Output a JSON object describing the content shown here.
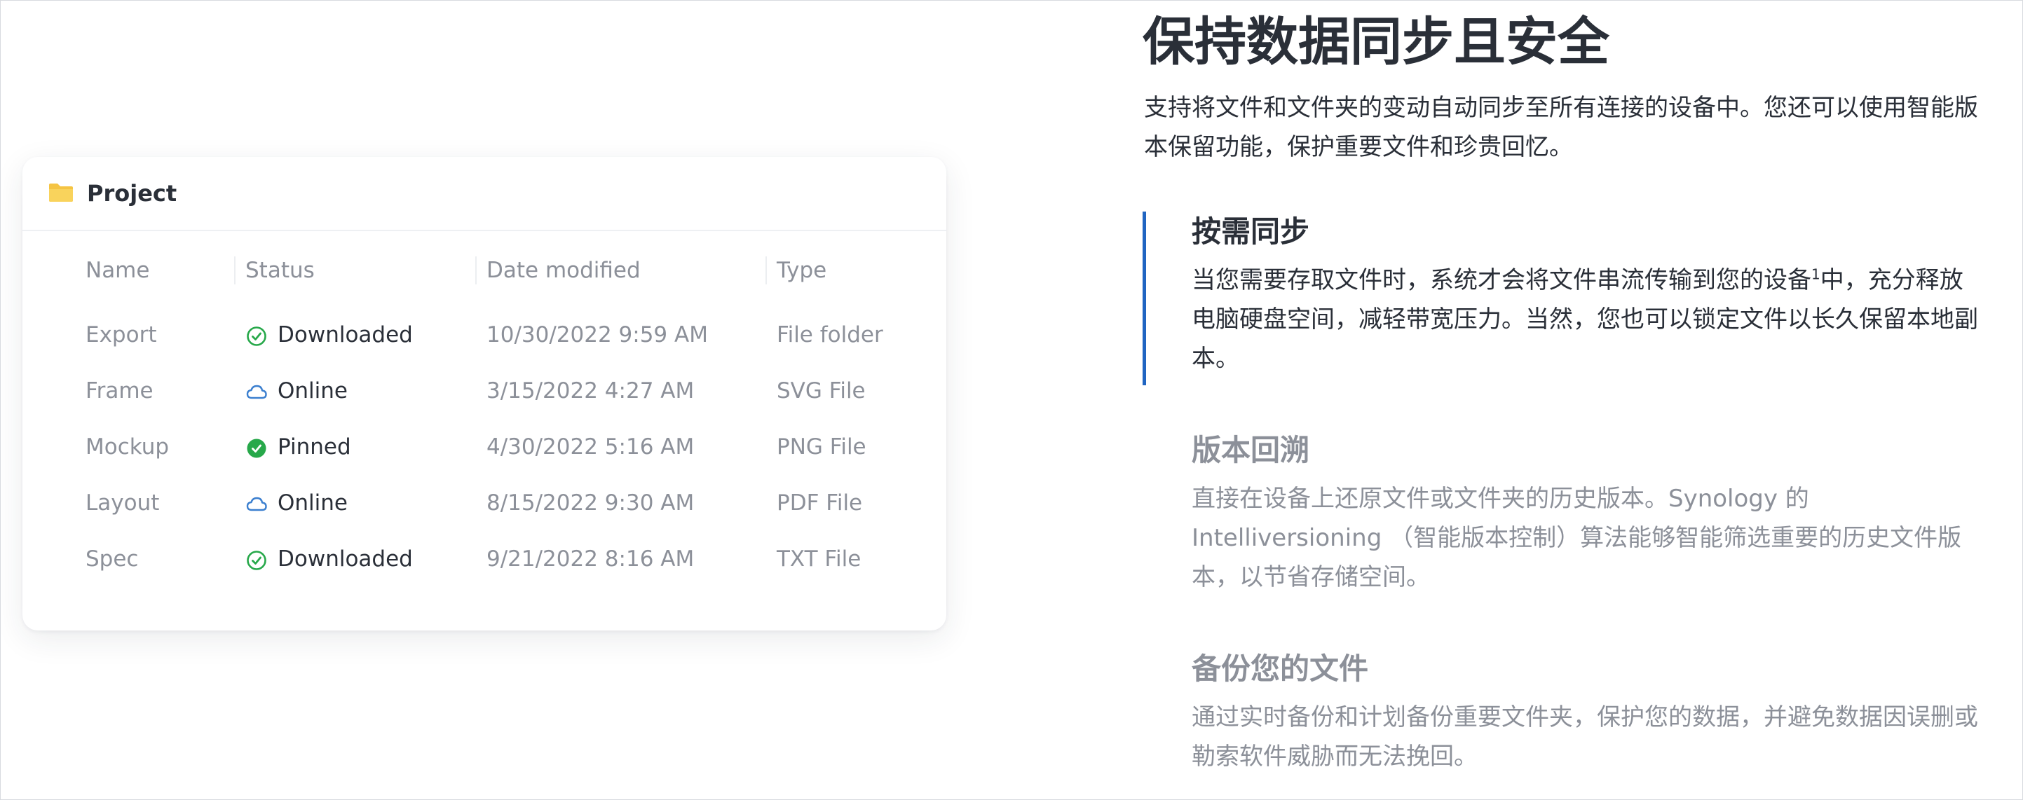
{
  "explorer": {
    "title": "Project",
    "columns": {
      "name": "Name",
      "status": "Status",
      "date": "Date modified",
      "type": "Type"
    },
    "rows": [
      {
        "name": "Export",
        "status": "Downloaded",
        "status_icon": "check-circle-outline-icon",
        "date": "10/30/2022 9:59 AM",
        "type": "File folder"
      },
      {
        "name": "Frame",
        "status": "Online",
        "status_icon": "cloud-icon",
        "date": "3/15/2022 4:27 AM",
        "type": "SVG File"
      },
      {
        "name": "Mockup",
        "status": "Pinned",
        "status_icon": "check-circle-filled-icon",
        "date": "4/30/2022 5:16 AM",
        "type": "PNG File"
      },
      {
        "name": "Layout",
        "status": "Online",
        "status_icon": "cloud-icon",
        "date": "8/15/2022 9:30 AM",
        "type": "PDF File"
      },
      {
        "name": "Spec",
        "status": "Downloaded",
        "status_icon": "check-circle-outline-icon",
        "date": "9/21/2022 8:16 AM",
        "type": "TXT File"
      }
    ]
  },
  "content": {
    "heading": "保持数据同步且安全",
    "intro": "支持将文件和文件夹的变动自动同步至所有连接的设备中。您还可以使用智能版本保留功能，保护重要文件和珍贵回忆。",
    "features": [
      {
        "title": "按需同步",
        "body_before": "当您需要存取文件时，系统才会将文件串流传输到您的设备",
        "body_sup": "1",
        "body_after": "中，充分释放电脑硬盘空间，减轻带宽压力。当然，您也可以锁定文件以长久保留本地副本。"
      },
      {
        "title": "版本回溯",
        "body": "直接在设备上还原文件或文件夹的历史版本。Synology 的 Intelliversioning （智能版本控制）算法能够智能筛选重要的历史文件版本，以节省存储空间。"
      },
      {
        "title": "备份您的文件",
        "body": "通过实时备份和计划备份重要文件夹，保护您的数据，并避免数据因误删或勒索软件威胁而无法挽回。"
      }
    ]
  },
  "colors": {
    "accent": "#2065c2",
    "check_green": "#27a84a",
    "cloud_blue": "#3b7fcf",
    "folder_yellow": "#f5c443",
    "text_dark": "#2a2f38",
    "text_muted": "#8c9099"
  }
}
